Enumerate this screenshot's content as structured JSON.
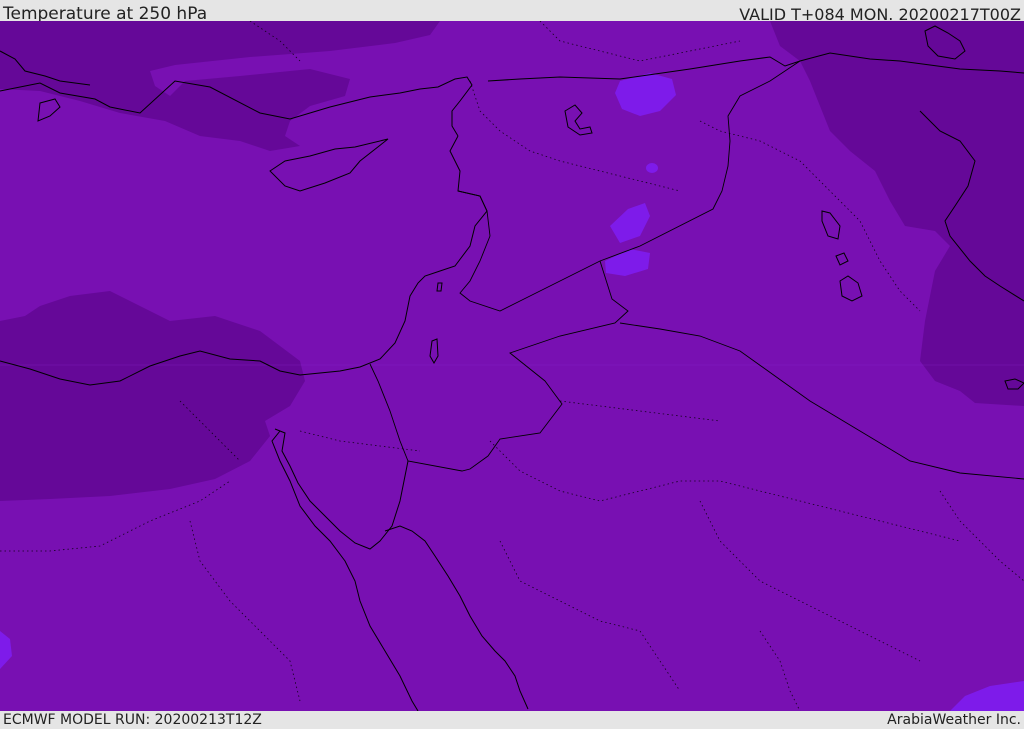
{
  "header": {
    "title": "Temperature at 250 hPa",
    "valid": "VALID T+084 MON. 20200217T00Z"
  },
  "footer": {
    "model_run": "ECMWF MODEL RUN: 20200213T12Z",
    "credit": "ArabiaWeather Inc."
  },
  "colors": {
    "base_field": "#7810b2",
    "cold_field": "#650898",
    "warm_patch": "#7e1bea",
    "coastline": "#000000",
    "bar_bg": "#e5e5e5"
  }
}
